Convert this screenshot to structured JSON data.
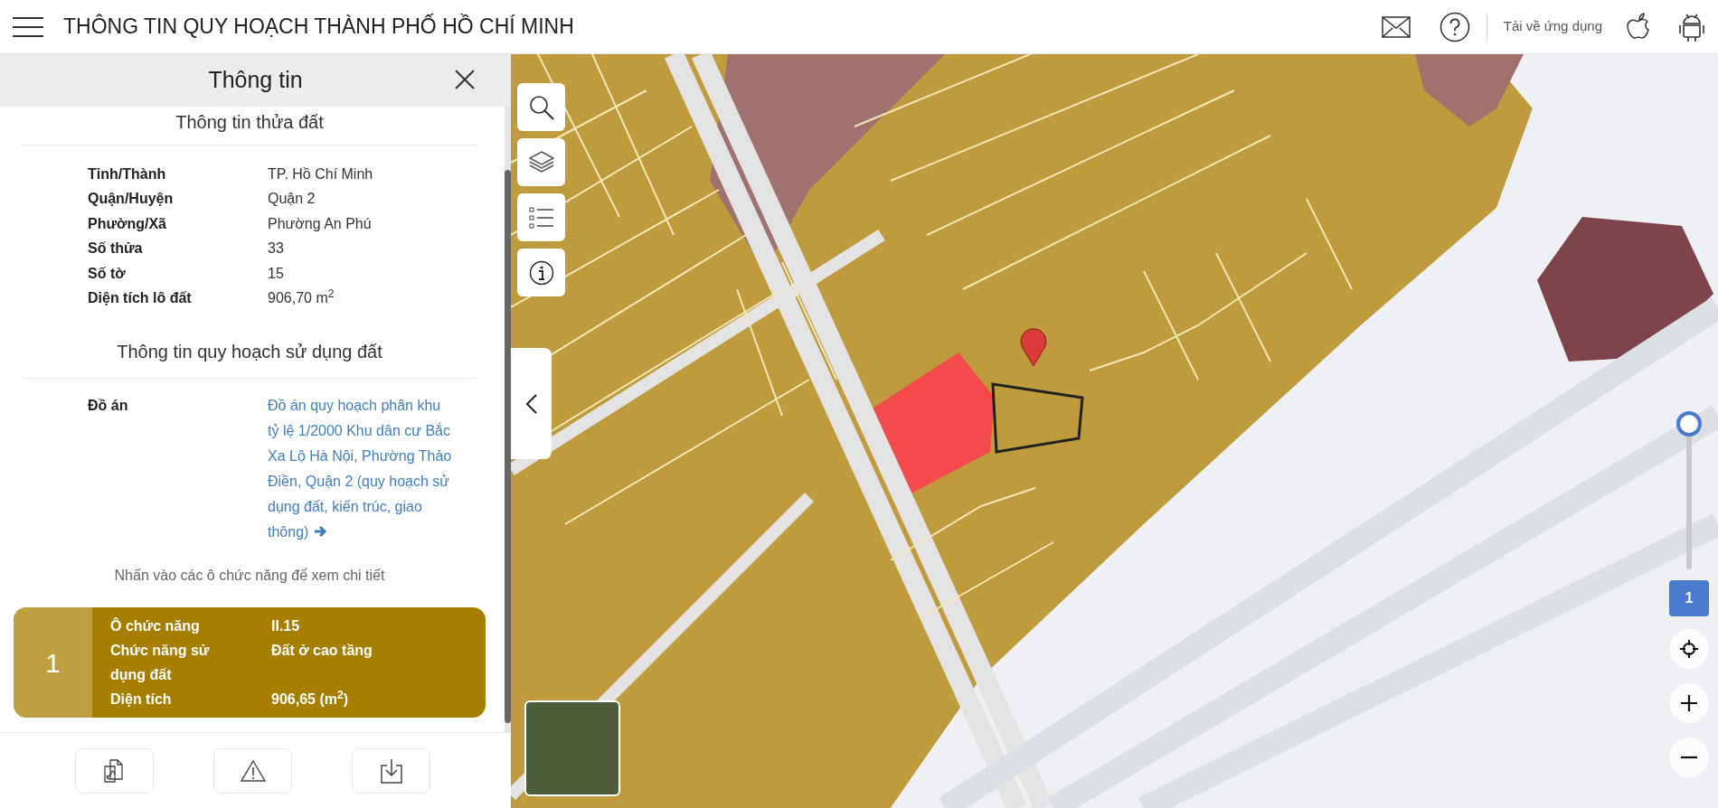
{
  "header": {
    "title": "THÔNG TIN QUY HOẠCH THÀNH PHỐ HỒ CHÍ MINH",
    "download_label": "Tải về ứng dụng"
  },
  "panel": {
    "title": "Thông tin",
    "parcel_heading": "Thông tin thửa đất",
    "parcel_rows": [
      {
        "label": "Tỉnh/Thành",
        "value": "TP. Hồ Chí Minh"
      },
      {
        "label": "Quận/Huyện",
        "value": "Quận 2"
      },
      {
        "label": "Phường/Xã",
        "value": "Phường An Phú"
      },
      {
        "label": "Số thửa",
        "value": "33"
      },
      {
        "label": "Số tờ",
        "value": "15"
      },
      {
        "label": "Diện tích lô đất",
        "value": "906,70 m$^{2}$"
      }
    ],
    "plan_heading": "Thông tin quy hoạch sử dụng đất",
    "plan_label": "Đồ án",
    "plan_link": "Đồ án quy hoạch phân khu tỷ lệ 1/2000 Khu dân cư Bắc Xa Lộ Hà Nội, Phường Thảo Điền, Quận 2 (quy hoạch sử dụng đất, kiến trúc, giao thông)",
    "hint": "Nhấn vào các ô chức năng để xem chi tiết",
    "zones": [
      {
        "number": "1",
        "color": "#a77f00",
        "rows": [
          {
            "label": "Ô chức năng",
            "value": "II.15"
          },
          {
            "label": "Chức năng sử dụng đất",
            "value": "Đất ở cao tầng"
          },
          {
            "label": "Diện tích",
            "value": "906,65 (m$^{2}$)"
          }
        ]
      }
    ]
  },
  "map": {
    "opacity_slider": {
      "level": 1,
      "reading": "1"
    }
  }
}
